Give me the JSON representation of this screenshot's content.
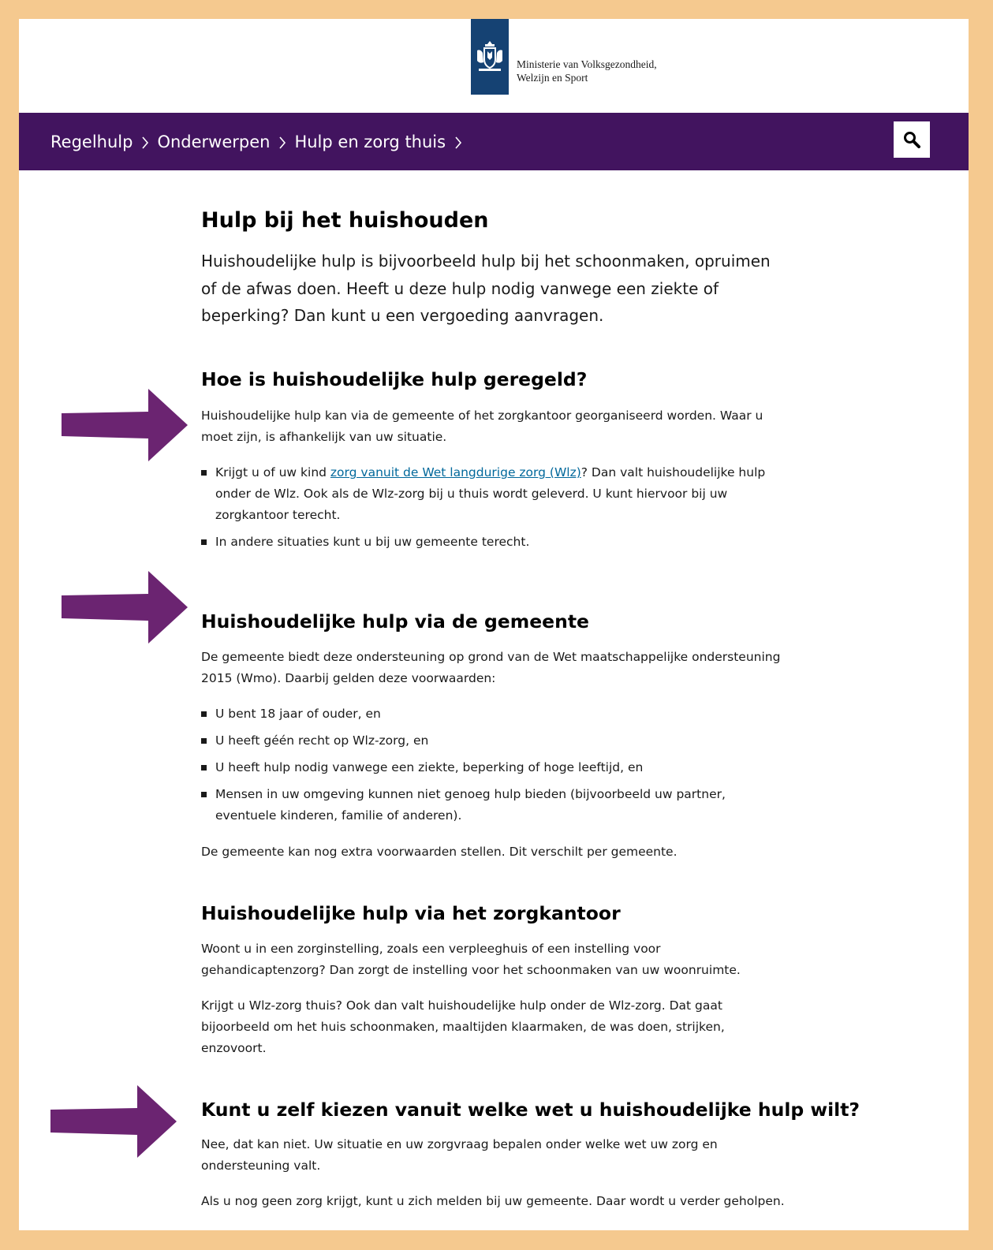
{
  "header": {
    "org_line1": "Ministerie van Volksgezondheid,",
    "org_line2": "Welzijn en Sport"
  },
  "breadcrumb": [
    "Regelhulp",
    "Onderwerpen",
    "Hulp en zorg thuis"
  ],
  "colors": {
    "nav_bg": "#42145f",
    "logo_bg": "#154273",
    "arrow": "#6b2471",
    "frame": "#f5c98f",
    "link": "#01689b"
  },
  "icons": {
    "search": "search-icon",
    "chevron": "chevron-right-icon",
    "arrow": "arrow-right-icon"
  },
  "page": {
    "title": "Hulp bij het huishouden",
    "intro": "Huishoudelijke hulp is bijvoorbeeld hulp bij het schoonmaken, opruimen of de afwas doen. Heeft u deze hulp nodig vanwege een ziekte of beperking? Dan kunt u een vergoeding aanvragen."
  },
  "sections": {
    "geregeld": {
      "heading": "Hoe is huishoudelijke hulp geregeld?",
      "para": "Huishoudelijke hulp kan via de gemeente of het zorgkantoor georganiseerd worden. Waar u moet zijn, is afhankelijk van uw situatie.",
      "item1_pre": "Krijgt u of uw kind ",
      "item1_link": "zorg vanuit de Wet langdurige zorg (Wlz)",
      "item1_post": "? Dan valt huishoudelijke hulp onder de Wlz. Ook als de Wlz-zorg bij u thuis wordt geleverd. U kunt hiervoor bij uw zorgkantoor terecht.",
      "item2": "In andere situaties kunt u bij uw gemeente terecht."
    },
    "gemeente": {
      "heading": "Huishoudelijke hulp via de gemeente",
      "para": "De gemeente biedt deze ondersteuning op grond van de Wet maatschappelijke ondersteuning 2015 (Wmo). Daarbij gelden deze voorwaarden:",
      "items": [
        "U bent 18 jaar of ouder, en",
        "U heeft géén recht op Wlz-zorg, en",
        "U heeft hulp nodig vanwege een ziekte, beperking of hoge leeftijd, en",
        "Mensen in uw omgeving kunnen niet genoeg hulp bieden (bijvoorbeeld uw partner, eventuele kinderen, familie of anderen)."
      ],
      "footer": "De gemeente kan nog extra voorwaarden stellen. Dit verschilt per gemeente."
    },
    "zorgkantoor": {
      "heading": "Huishoudelijke hulp via het zorgkantoor",
      "para1": "Woont u in een zorginstelling, zoals een verpleeghuis of een instelling voor gehandicaptenzorg? Dan zorgt de instelling voor het schoonmaken van uw woonruimte.",
      "para2": "Krijgt u Wlz-zorg thuis? Ook dan valt huishoudelijke hulp onder de Wlz-zorg. Dat gaat bijoorbeeld om het huis schoonmaken, maaltijden klaarmaken, de was doen, strijken, enzovoort."
    },
    "kiezen": {
      "heading": "Kunt u zelf kiezen vanuit welke wet u huishoudelijke hulp wilt?",
      "para1": "Nee, dat kan niet. Uw situatie en uw zorgvraag bepalen onder welke wet uw zorg en ondersteuning valt.",
      "para2": "Als u nog geen zorg krijgt, kunt u zich melden bij uw gemeente. Daar wordt u verder geholpen."
    }
  }
}
